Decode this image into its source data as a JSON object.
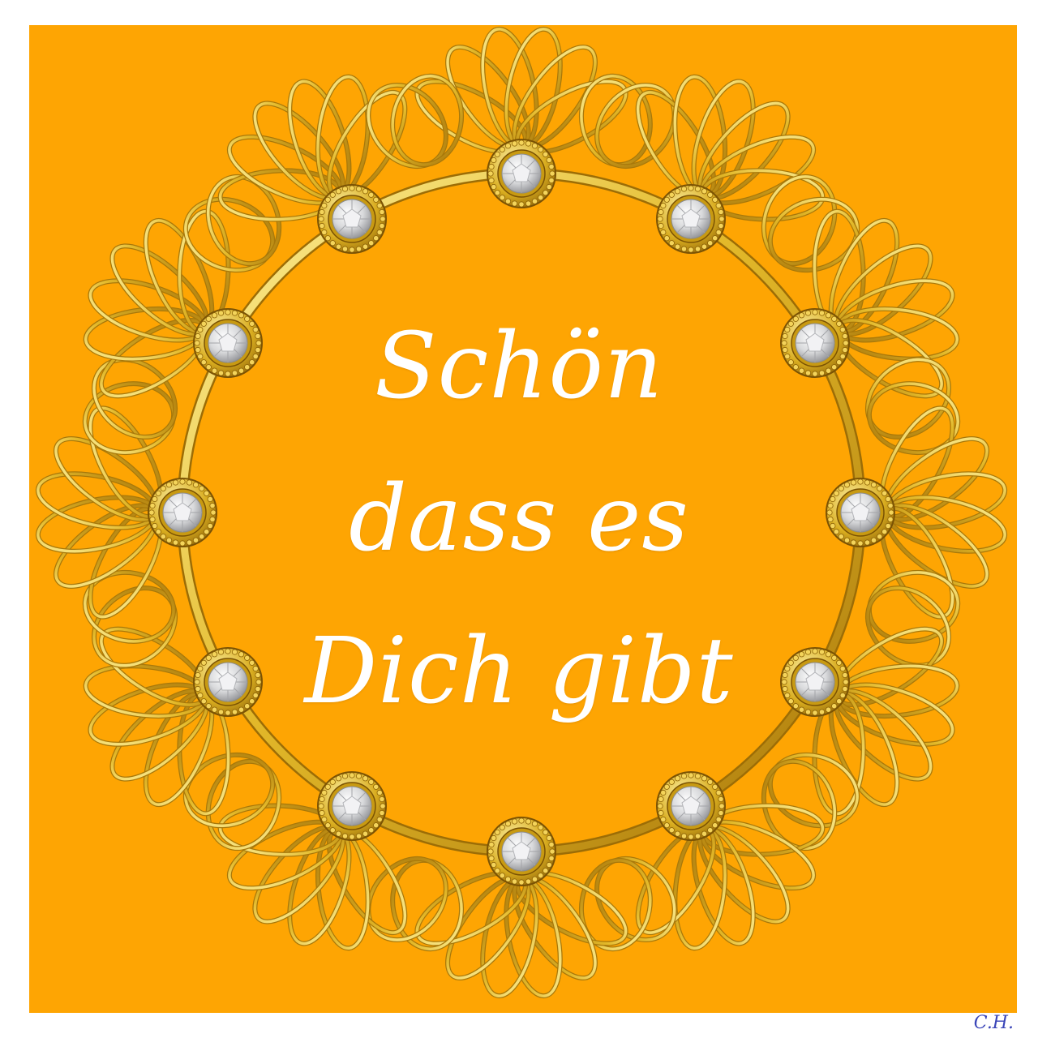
{
  "background_color": "#fea503",
  "frame_color": "#e8c43a",
  "gem_color": "#e9e9ea",
  "greeting": {
    "line1": "Schön",
    "line2": "dass es",
    "line3": "Dich gibt"
  },
  "signature": "C.H.",
  "ornament": {
    "name": "golden-filigree-frame",
    "gem_count": 12,
    "icon": "diamond-gem-icon"
  }
}
